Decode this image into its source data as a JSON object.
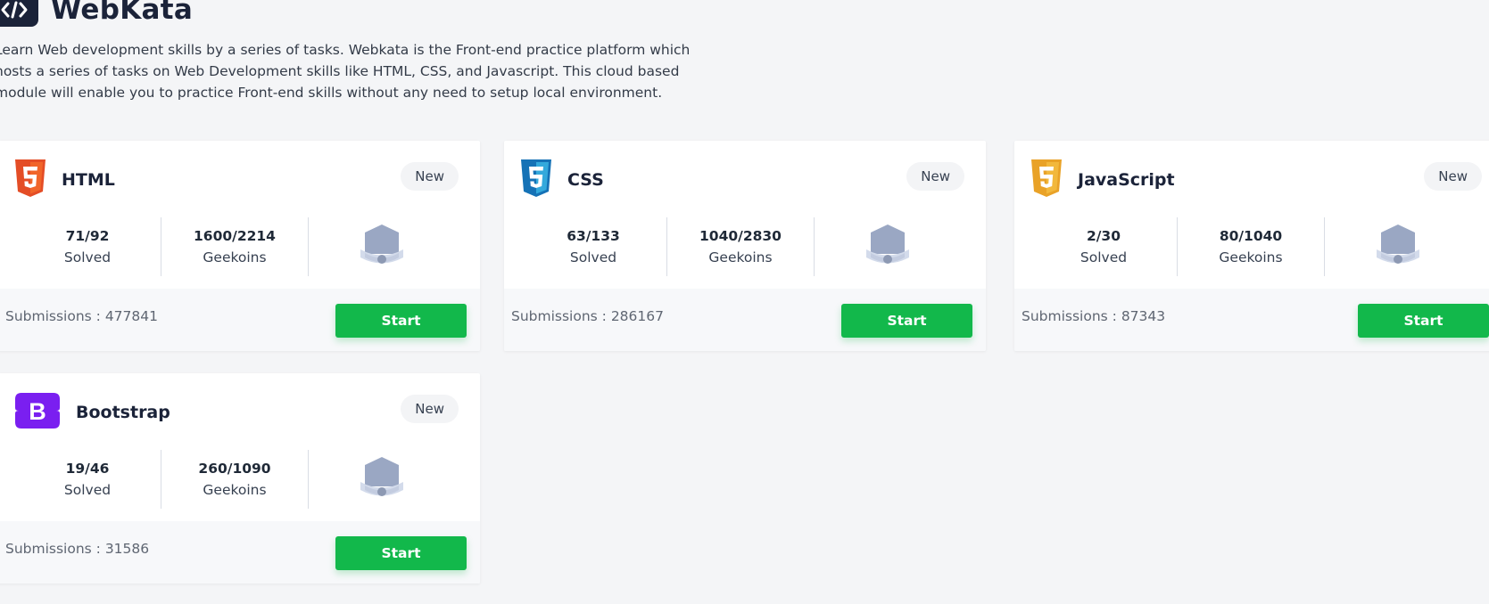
{
  "header": {
    "title": "WebKata",
    "logo_icon": "code-icon",
    "intro_text": "Learn Web development skills by a series of tasks. Webkata is the Front-end practice platform which hosts a series of tasks on Web Development skills like HTML, CSS, and Javascript. This cloud based module will enable you to practice Front-end skills without any need to setup local environment."
  },
  "cards": [
    {
      "name": "HTML",
      "icon": "html5-icon",
      "icon_color": "#e44d26",
      "badge": "New",
      "solved": "71/92",
      "solved_label": "Solved",
      "geekoins": "1600/2214",
      "geekoins_label": "Geekoins",
      "submissions": "Submissions : 477841",
      "button": "Start"
    },
    {
      "name": "CSS",
      "icon": "css3-icon",
      "icon_color": "#1572b6",
      "badge": "New",
      "solved": "63/133",
      "solved_label": "Solved",
      "geekoins": "1040/2830",
      "geekoins_label": "Geekoins",
      "submissions": "Submissions : 286167",
      "button": "Start"
    },
    {
      "name": "JavaScript",
      "icon": "javascript-icon",
      "icon_color": "#e9a227",
      "badge": "New",
      "solved": "2/30",
      "solved_label": "Solved",
      "geekoins": "80/1040",
      "geekoins_label": "Geekoins",
      "submissions": "Submissions : 87343",
      "button": "Start"
    },
    {
      "name": "Bootstrap",
      "icon": "bootstrap-icon",
      "icon_color": "#7a1ff0",
      "badge": "New",
      "solved": "19/46",
      "solved_label": "Solved",
      "geekoins": "260/1090",
      "geekoins_label": "Geekoins",
      "submissions": "Submissions : 31586",
      "button": "Start"
    }
  ],
  "colors": {
    "background": "#f4f5f7",
    "start_button": "#12b84b",
    "navy": "#1b2339",
    "badge_fill": "#9aa7c3"
  }
}
